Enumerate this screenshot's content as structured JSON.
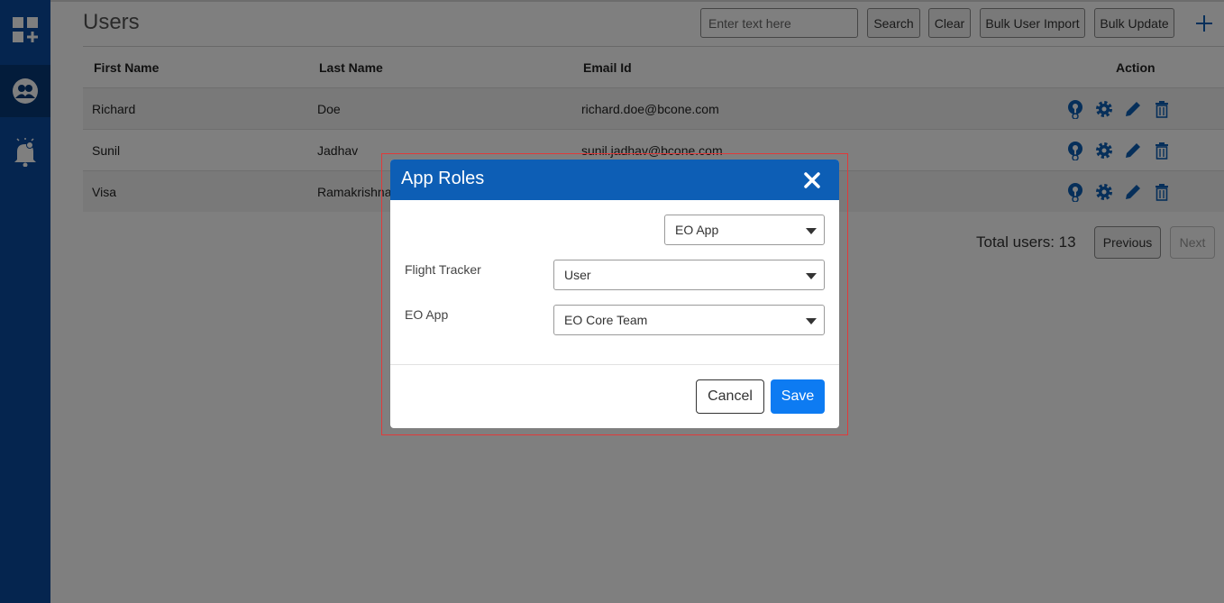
{
  "page": {
    "title": "Users"
  },
  "toolbar": {
    "search_placeholder": "Enter text here",
    "search_label": "Search",
    "clear_label": "Clear",
    "bulk_import_label": "Bulk User Import",
    "bulk_update_label": "Bulk Update"
  },
  "table": {
    "headers": [
      "First Name",
      "Last Name",
      "Email Id",
      "Action"
    ],
    "rows": [
      {
        "first": "Richard",
        "last": "Doe",
        "email": "richard.doe@bcone.com"
      },
      {
        "first": "Sunil",
        "last": "Jadhav",
        "email": "sunil.jadhav@bcone.com"
      },
      {
        "first": "Visa",
        "last": "Ramakrishnan",
        "email": ""
      }
    ]
  },
  "pagination": {
    "total": "Total users: 13",
    "previous": "Previous",
    "next": "Next"
  },
  "modal": {
    "title": "App Roles",
    "app_select": "EO App",
    "fields": [
      {
        "label": "Flight Tracker",
        "value": "User"
      },
      {
        "label": "EO App",
        "value": "EO Core Team"
      }
    ],
    "cancel_label": "Cancel",
    "save_label": "Save"
  },
  "colors": {
    "sidebar": "#0a4a9e",
    "sidebar_active": "#063876",
    "modal_header": "#0d5eb5",
    "primary": "#0d7bf2",
    "action_icon": "#0d5eb5",
    "highlight": "#e03a3a"
  },
  "icons": {
    "sidebar": [
      "apps-add-icon",
      "users-group-icon",
      "bell-alert-icon"
    ],
    "row_actions": [
      "user-key-icon",
      "gear-icon",
      "pencil-icon",
      "trash-icon"
    ],
    "toolbar_add": "plus-icon",
    "modal_close": "close-icon"
  }
}
